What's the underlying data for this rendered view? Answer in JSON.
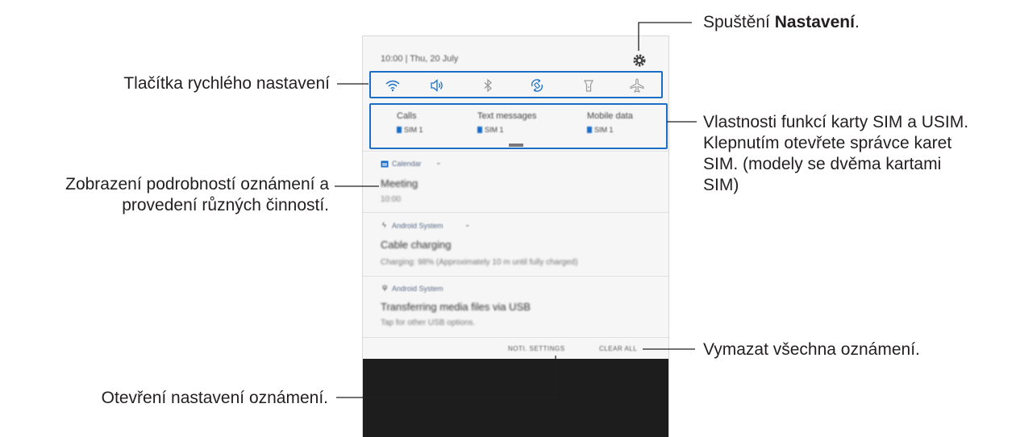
{
  "phone": {
    "status_text": "10:00 | Thu, 20 July",
    "quick_settings": [
      {
        "icon": "wifi-icon",
        "active": true
      },
      {
        "icon": "sound-icon",
        "active": true
      },
      {
        "icon": "bluetooth-icon",
        "active": false
      },
      {
        "icon": "auto-rotate-icon",
        "active": true
      },
      {
        "icon": "flashlight-icon",
        "active": false
      },
      {
        "icon": "airplane-mode-icon",
        "active": false
      }
    ],
    "sim": [
      {
        "title": "Calls",
        "sub": "SIM 1"
      },
      {
        "title": "Text messages",
        "sub": "SIM 1"
      },
      {
        "title": "Mobile data",
        "sub": "SIM 1"
      }
    ],
    "notifications": [
      {
        "app": "Calendar",
        "title": "Meeting",
        "sub": "10:00"
      },
      {
        "app": "Android System",
        "title": "Cable charging",
        "sub": "Charging: 98% (Approximately 10 m until fully charged)"
      },
      {
        "app": "Android System",
        "title": "Transferring media files via USB",
        "sub": "Tap for other USB options."
      }
    ],
    "actions": {
      "settings": "NOTI. SETTINGS",
      "clear": "CLEAR ALL"
    }
  },
  "callouts": {
    "settings_prefix": "Spuštění ",
    "settings_bold": "Nastavení",
    "settings_suffix": ".",
    "quick_settings": "Tlačítka rychlého nastavení",
    "details_line1": "Zobrazení podrobností oznámení a",
    "details_line2": "provedení různých činností.",
    "sim_line1": "Vlastnosti funkcí karty SIM a USIM.",
    "sim_line2": "Klepnutím otevřete správce karet",
    "sim_line3": "SIM. (modely se dvěma kartami",
    "sim_line4": "SIM)",
    "clear_all": "Vymazat všechna oznámení.",
    "noti_settings": "Otevření nastavení oznámení."
  },
  "colors": {
    "accent": "#1a6ec6",
    "dark": "#1d1d1d",
    "text": "#231f20"
  }
}
